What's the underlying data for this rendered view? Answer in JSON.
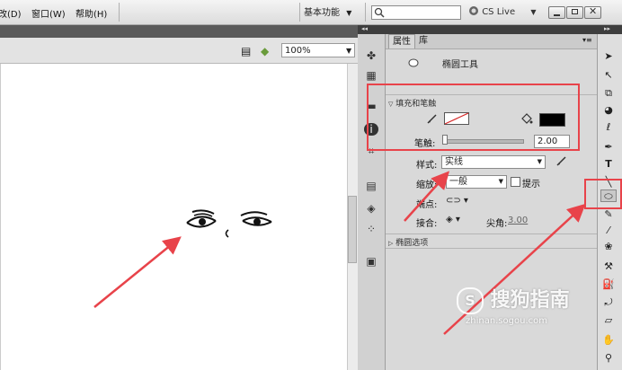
{
  "menu": {
    "items": [
      "改(D)",
      "窗口(W)",
      "帮助(H)"
    ],
    "workspace": "基本功能",
    "cs_live": "CS Live"
  },
  "document": {
    "zoom": "100%"
  },
  "panel": {
    "tabs": [
      "属性",
      "库"
    ],
    "tool_name": "椭圆工具",
    "fill_stroke_section": "填充和笔触",
    "stroke_label": "笔触",
    "stroke_value": "2.00",
    "style_label": "样式",
    "style_value": "实线",
    "scale_label": "缩放",
    "scale_value": "一般",
    "hint_label": "提示",
    "cap_label": "端点",
    "join_label": "接合",
    "miter_label": "尖角",
    "miter_value": "3.00",
    "ellipse_options": "椭圆选项"
  },
  "watermark": {
    "brand": "搜狗指南",
    "url": "zhinan.sogou.com"
  },
  "colors": {
    "annotation_red": "#e8434a",
    "stroke_swatch": "#ffffff",
    "fill_swatch": "#000000"
  }
}
